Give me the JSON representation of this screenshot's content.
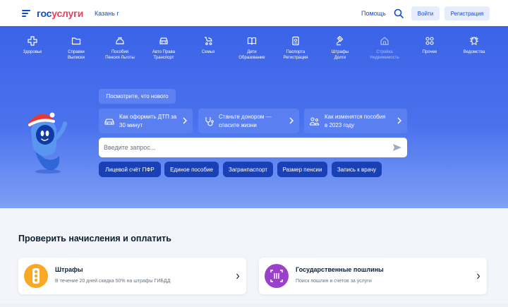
{
  "header": {
    "logo_part1": "гос",
    "logo_part2": "услуги",
    "city": "Казань г",
    "help": "Помощь",
    "login": "Войти",
    "register": "Регистрация"
  },
  "categories": [
    {
      "line1": "Здоровье",
      "line2": "",
      "icon": "health-cross-icon"
    },
    {
      "line1": "Справки",
      "line2": "Выписки",
      "icon": "folder-icon"
    },
    {
      "line1": "Пособия",
      "line2": "Пенсия Льготы",
      "icon": "money-bag-icon"
    },
    {
      "line1": "Авто Права",
      "line2": "Транспорт",
      "icon": "car-icon"
    },
    {
      "line1": "Семья",
      "line2": "",
      "icon": "stroller-icon"
    },
    {
      "line1": "Дети",
      "line2": "Образование",
      "icon": "book-icon"
    },
    {
      "line1": "Паспорта",
      "line2": "Регистрация",
      "icon": "passport-icon"
    },
    {
      "line1": "Штрафы",
      "line2": "Долги",
      "icon": "gavel-icon"
    },
    {
      "line1": "Стройка",
      "line2": "Недвижимость",
      "icon": "house-icon"
    },
    {
      "line1": "Прочее",
      "line2": "",
      "icon": "grid-icon"
    },
    {
      "line1": "Ведомства",
      "line2": "",
      "icon": "emblem-icon"
    }
  ],
  "whats_new": "Посмотрите, что нового",
  "promos": [
    {
      "line1": "Как оформить ДТП за",
      "line2": "30 минут",
      "icon": "car-accident-icon"
    },
    {
      "line1": "Станьте донором —",
      "line2": "спасите жизни",
      "icon": "stethoscope-icon"
    },
    {
      "line1": "Как изменятся пособия",
      "line2": "в 2023 году",
      "icon": "family-icon"
    }
  ],
  "search": {
    "placeholder": "Введите запрос..."
  },
  "chips": [
    "Лицевой счёт ПФР",
    "Единое пособие",
    "Загранпаспорт",
    "Размер пенсии",
    "Запись к врачу"
  ],
  "section": {
    "title": "Проверить начисления и оплатить"
  },
  "cards": [
    {
      "title": "Штрафы",
      "subtitle": "В течение 20 дней скидка 50% на штрафы ГИБДД",
      "icon": "traffic-light-icon",
      "color": "#f9a825"
    },
    {
      "title": "Государственные пошлины",
      "subtitle": "Поиск пошлин и счетов за услуги",
      "icon": "receipt-scan-icon",
      "color": "#9a40c9"
    }
  ],
  "colors": {
    "brand_blue": "#0d4cd3",
    "brand_red": "#ee3f58",
    "hero_blue": "#3b63e6",
    "chip_blue": "#1a40b5"
  }
}
